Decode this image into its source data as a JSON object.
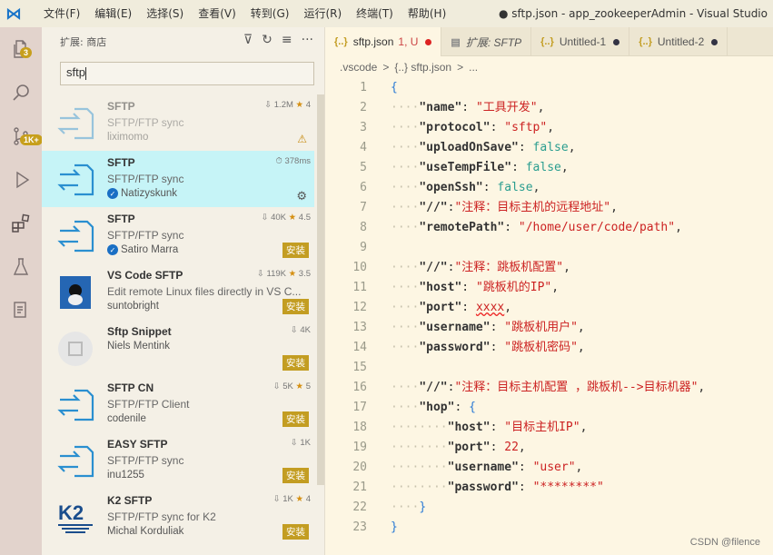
{
  "window": {
    "title": "● sftp.json - app_zookeeperAdmin - Visual Studio",
    "menu": [
      "文件(F)",
      "编辑(E)",
      "选择(S)",
      "查看(V)",
      "转到(G)",
      "运行(R)",
      "终端(T)",
      "帮助(H)"
    ]
  },
  "activity": {
    "explorer_badge": "3",
    "scm_badge": "1K+"
  },
  "sidebar": {
    "header": "扩展: 商店",
    "search_value": "sftp",
    "extensions": [
      {
        "name": "SFTP",
        "desc": "SFTP/FTP sync",
        "publisher": "liximomo",
        "downloads": "1.2M",
        "rating": "4",
        "state": "warn",
        "verified": false,
        "dim": true,
        "selected": false,
        "logo": "sftp"
      },
      {
        "name": "SFTP",
        "desc": "SFTP/FTP sync",
        "publisher": "Natizyskunk",
        "downloads": "",
        "time": "378ms",
        "rating": "",
        "state": "gear",
        "verified": true,
        "dim": false,
        "selected": true,
        "logo": "sftp"
      },
      {
        "name": "SFTP",
        "desc": "SFTP/FTP sync",
        "publisher": "Satiro Marra",
        "downloads": "40K",
        "rating": "4.5",
        "state": "install",
        "verified": true,
        "dim": false,
        "selected": false,
        "logo": "sftp"
      },
      {
        "name": "VS Code SFTP",
        "desc": "Edit remote Linux files directly in VS C...",
        "publisher": "suntobright",
        "downloads": "119K",
        "rating": "3.5",
        "state": "install",
        "verified": false,
        "dim": false,
        "selected": false,
        "logo": "linux"
      },
      {
        "name": "Sftp Snippet",
        "desc": "",
        "publisher": "Niels Mentink",
        "downloads": "4K",
        "rating": "",
        "state": "install",
        "verified": false,
        "dim": false,
        "selected": false,
        "logo": "snippet"
      },
      {
        "name": "SFTP CN",
        "desc": "SFTP/FTP Client",
        "publisher": "codenile",
        "downloads": "5K",
        "rating": "5",
        "state": "install",
        "verified": false,
        "dim": false,
        "selected": false,
        "logo": "sftp"
      },
      {
        "name": "EASY SFTP",
        "desc": "SFTP/FTP sync",
        "publisher": "inu1255",
        "downloads": "1K",
        "rating": "",
        "state": "install",
        "verified": false,
        "dim": false,
        "selected": false,
        "logo": "sftp"
      },
      {
        "name": "K2 SFTP",
        "desc": "SFTP/FTP sync for K2",
        "publisher": "Michal Korduliak",
        "downloads": "1K",
        "rating": "4",
        "state": "install",
        "verified": false,
        "dim": false,
        "selected": false,
        "logo": "k2"
      }
    ],
    "install_label": "安装"
  },
  "editor": {
    "tabs": [
      {
        "label": "sftp.json",
        "status": "1, U",
        "active": true,
        "dot": "#d22",
        "icon": "{..}"
      },
      {
        "label": "扩展: SFTP",
        "status": "",
        "active": false,
        "dot": "",
        "icon": "ext"
      },
      {
        "label": "Untitled-1",
        "status": "",
        "active": false,
        "dot": "#334",
        "icon": "{..}"
      },
      {
        "label": "Untitled-2",
        "status": "",
        "active": false,
        "dot": "#334",
        "icon": "{..}"
      }
    ],
    "breadcrumb": [
      ".vscode",
      ">",
      "{..} sftp.json",
      ">",
      "..."
    ],
    "lines": [
      [
        [
          "b",
          "{"
        ]
      ],
      [
        [
          "ws",
          "····"
        ],
        [
          "k",
          "\"name\""
        ],
        [
          "p",
          ": "
        ],
        [
          "s",
          "\"工具开发\""
        ],
        [
          "p",
          ","
        ]
      ],
      [
        [
          "ws",
          "····"
        ],
        [
          "k",
          "\"protocol\""
        ],
        [
          "p",
          ": "
        ],
        [
          "s",
          "\"sftp\""
        ],
        [
          "p",
          ","
        ]
      ],
      [
        [
          "ws",
          "····"
        ],
        [
          "k",
          "\"uploadOnSave\""
        ],
        [
          "p",
          ": "
        ],
        [
          "n",
          "false"
        ],
        [
          "p",
          ","
        ]
      ],
      [
        [
          "ws",
          "····"
        ],
        [
          "k",
          "\"useTempFile\""
        ],
        [
          "p",
          ": "
        ],
        [
          "n",
          "false"
        ],
        [
          "p",
          ","
        ]
      ],
      [
        [
          "ws",
          "····"
        ],
        [
          "k",
          "\"openSsh\""
        ],
        [
          "p",
          ": "
        ],
        [
          "n",
          "false"
        ],
        [
          "p",
          ","
        ]
      ],
      [
        [
          "ws",
          "····"
        ],
        [
          "k",
          "\"//\""
        ],
        [
          "p",
          ":"
        ],
        [
          "s",
          "\"注释：目标主机的远程地址\""
        ],
        [
          "p",
          ","
        ]
      ],
      [
        [
          "ws",
          "····"
        ],
        [
          "k",
          "\"remotePath\""
        ],
        [
          "p",
          ": "
        ],
        [
          "s",
          "\"/home/user/code/path\""
        ],
        [
          "p",
          ","
        ]
      ],
      [],
      [
        [
          "ws",
          "····"
        ],
        [
          "k",
          "\"//\""
        ],
        [
          "p",
          ":"
        ],
        [
          "s",
          "\"注释：跳板机配置\""
        ],
        [
          "p",
          ","
        ]
      ],
      [
        [
          "ws",
          "····"
        ],
        [
          "k",
          "\"host\""
        ],
        [
          "p",
          ": "
        ],
        [
          "s",
          "\"跳板机的IP\""
        ],
        [
          "p",
          ","
        ]
      ],
      [
        [
          "ws",
          "····"
        ],
        [
          "k",
          "\"port\""
        ],
        [
          "p",
          ": "
        ],
        [
          "e",
          "xxxx"
        ],
        [
          "p",
          ","
        ]
      ],
      [
        [
          "ws",
          "····"
        ],
        [
          "k",
          "\"username\""
        ],
        [
          "p",
          ": "
        ],
        [
          "s",
          "\"跳板机用户\""
        ],
        [
          "p",
          ","
        ]
      ],
      [
        [
          "ws",
          "····"
        ],
        [
          "k",
          "\"password\""
        ],
        [
          "p",
          ": "
        ],
        [
          "s",
          "\"跳板机密码\""
        ],
        [
          "p",
          ","
        ]
      ],
      [],
      [
        [
          "ws",
          "····"
        ],
        [
          "k",
          "\"//\""
        ],
        [
          "p",
          ":"
        ],
        [
          "s",
          "\"注释：目标主机配置 ，跳板机-->目标机器\""
        ],
        [
          "p",
          ","
        ]
      ],
      [
        [
          "ws",
          "····"
        ],
        [
          "k",
          "\"hop\""
        ],
        [
          "p",
          ": "
        ],
        [
          "b",
          "{"
        ]
      ],
      [
        [
          "ws",
          "········"
        ],
        [
          "k",
          "\"host\""
        ],
        [
          "p",
          ": "
        ],
        [
          "s",
          "\"目标主机IP\""
        ],
        [
          "p",
          ","
        ]
      ],
      [
        [
          "ws",
          "········"
        ],
        [
          "k",
          "\"port\""
        ],
        [
          "p",
          ": "
        ],
        [
          "s",
          "22"
        ],
        [
          "p",
          ","
        ]
      ],
      [
        [
          "ws",
          "········"
        ],
        [
          "k",
          "\"username\""
        ],
        [
          "p",
          ": "
        ],
        [
          "s",
          "\"user\""
        ],
        [
          "p",
          ","
        ]
      ],
      [
        [
          "ws",
          "········"
        ],
        [
          "k",
          "\"password\""
        ],
        [
          "p",
          ": "
        ],
        [
          "s",
          "\"********\""
        ]
      ],
      [
        [
          "ws",
          "····"
        ],
        [
          "b",
          "}"
        ]
      ],
      [
        [
          "b",
          "}"
        ]
      ]
    ]
  },
  "watermark": "CSDN @filence"
}
